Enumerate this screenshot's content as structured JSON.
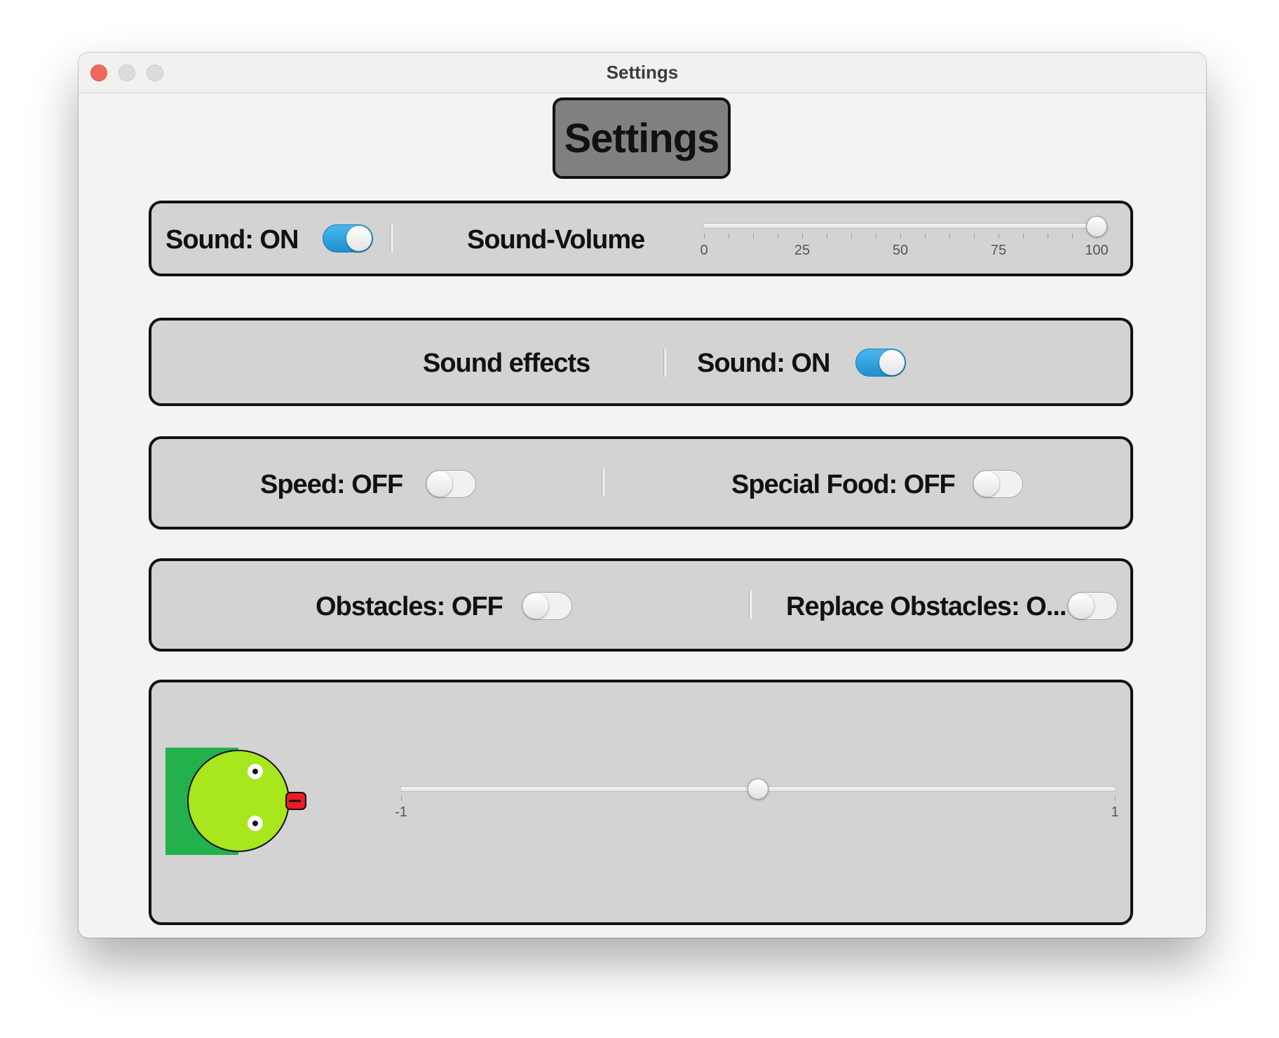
{
  "window": {
    "title": "Settings"
  },
  "heading": "Settings",
  "row1": {
    "sound_label": "Sound: ON",
    "sound_toggle": true,
    "volume_label": "Sound-Volume",
    "volume_slider": {
      "min": 0,
      "max": 100,
      "value": 100,
      "tick_labels": [
        "0",
        "25",
        "50",
        "75",
        "100"
      ]
    }
  },
  "row2": {
    "effects_label": "Sound effects",
    "sound_label": "Sound: ON",
    "sound_toggle": true
  },
  "row3": {
    "speed_label": "Speed: OFF",
    "speed_toggle": false,
    "special_food_label": "Special Food: OFF",
    "special_food_toggle": false
  },
  "row4": {
    "obstacles_label": "Obstacles: OFF",
    "obstacles_toggle": false,
    "replace_label": "Replace Obstacles: O...",
    "replace_toggle": false
  },
  "row5": {
    "snake_icon": "snake-head-icon",
    "slider": {
      "min": -1,
      "max": 1,
      "value": 0,
      "min_label": "-1",
      "max_label": "1"
    }
  },
  "colors": {
    "toggle_on": "#2a9fdc",
    "snake_body": "#22b14c",
    "snake_head": "#a8e61d",
    "snake_tongue": "#ed1c24"
  }
}
